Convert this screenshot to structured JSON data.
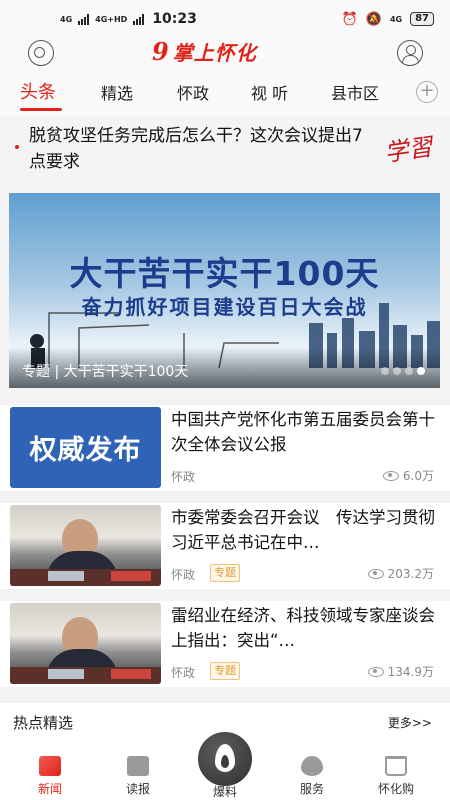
{
  "status_bar": {
    "network_1": "4G",
    "network_2": "4G+HD",
    "time": "10:23",
    "right_network": "4G",
    "battery": "87"
  },
  "header": {
    "logo_mark": "9",
    "logo_text": "掌上怀化",
    "brand_color": "#e2231a"
  },
  "tabs": [
    {
      "label": "头条",
      "active": true
    },
    {
      "label": "精选"
    },
    {
      "label": "怀政"
    },
    {
      "label": "视 听"
    },
    {
      "label": "县市区"
    }
  ],
  "headline": {
    "text": "脱贫攻坚任务完成后怎么干？这次会议提出7点要求",
    "tag": "学習"
  },
  "banner": {
    "title": "大干苦干实干100天",
    "subtitle": "奋力抓好项目建设百日大会战",
    "caption": "专题 | 大干苦干实干100天",
    "dots": 4,
    "active_dot": 4
  },
  "news": [
    {
      "thumb_text": "权威发布",
      "title": "中国共产党怀化市第五届委员会第十次全体会议公报",
      "source": "怀政",
      "badge": "",
      "views": "6.0万"
    },
    {
      "thumb_text": "",
      "title": "市委常委会召开会议　传达学习贯彻习近平总书记在中…",
      "source": "怀政",
      "badge": "专题",
      "views": "203.2万"
    },
    {
      "thumb_text": "",
      "title": "雷绍业在经济、科技领域专家座谈会上指出：突出“…",
      "source": "怀政",
      "badge": "专题",
      "views": "134.9万"
    }
  ],
  "hot": {
    "title": "热点精选",
    "more": "更多>>"
  },
  "bottom_nav": [
    {
      "label": "新闻",
      "icon": "news-icon",
      "active": true
    },
    {
      "label": "读报",
      "icon": "newspaper-icon"
    },
    {
      "label": "爆料",
      "icon": "flame-icon"
    },
    {
      "label": "服务",
      "icon": "heart-icon"
    },
    {
      "label": "怀化购",
      "icon": "cart-icon"
    }
  ]
}
